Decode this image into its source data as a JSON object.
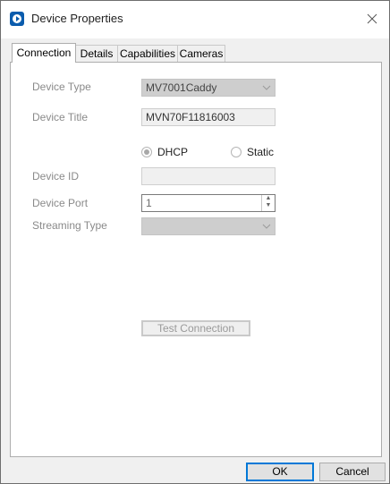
{
  "window": {
    "title": "Device Properties"
  },
  "tabs": [
    {
      "label": "Connection",
      "active": true
    },
    {
      "label": "Details",
      "active": false
    },
    {
      "label": "Capabilities",
      "active": false
    },
    {
      "label": "Cameras",
      "active": false
    }
  ],
  "connection": {
    "device_type_label": "Device Type",
    "device_type_value": "MV7001Caddy",
    "device_title_label": "Device Title",
    "device_title_value": "MVN70F11816003",
    "dhcp_label": "DHCP",
    "dhcp_selected": true,
    "static_label": "Static",
    "device_id_label": "Device ID",
    "device_id_value": "",
    "device_port_label": "Device Port",
    "device_port_value": "1",
    "streaming_type_label": "Streaming Type",
    "streaming_type_value": "",
    "test_connection_label": "Test Connection"
  },
  "footer": {
    "ok_label": "OK",
    "cancel_label": "Cancel"
  },
  "colors": {
    "accent": "#0078d7",
    "app_icon": "#0b5cad"
  },
  "icons": [
    "app-icon",
    "close-icon",
    "chevron-down-icon"
  ]
}
